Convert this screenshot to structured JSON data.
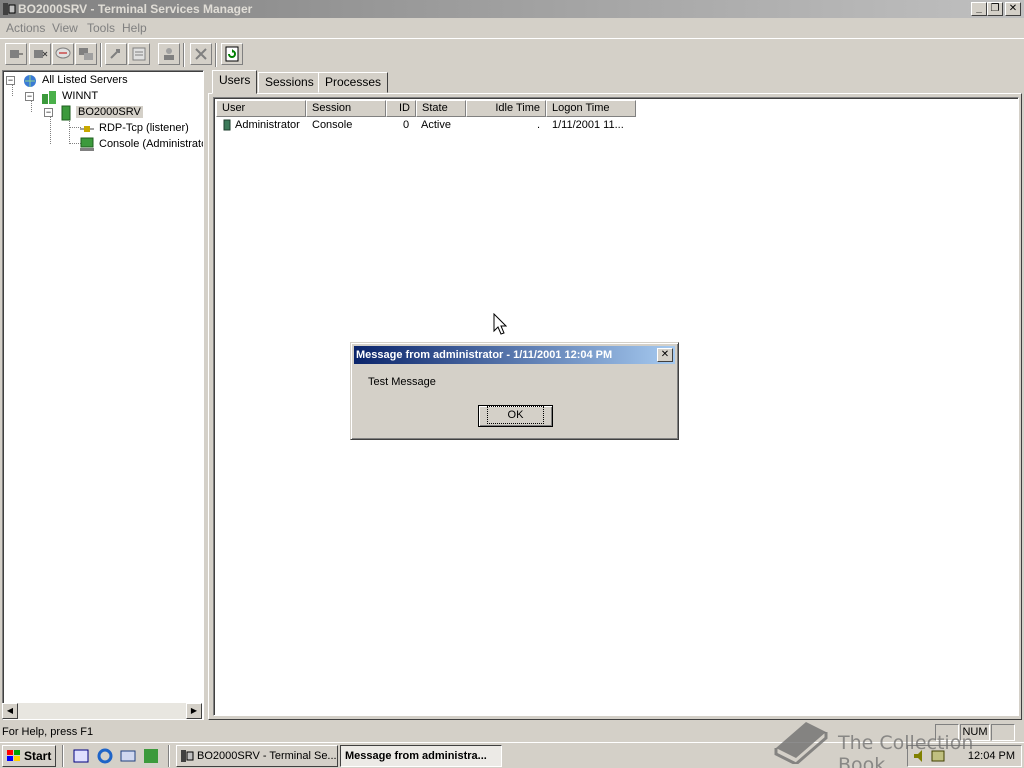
{
  "window": {
    "title": "BO2000SRV - Terminal Services Manager",
    "caption_buttons": {
      "minimize": "_",
      "restore": "❐",
      "close": "✕"
    }
  },
  "menu": [
    "Actions",
    "View",
    "Tools",
    "Help"
  ],
  "toolbar": {
    "buttons": [
      "connect-icon",
      "disconnect-icon",
      "send-message-icon",
      "remote-control-icon",
      "reset-icon",
      "status-icon",
      "logoff-icon",
      "end-process-icon",
      "refresh-icon"
    ]
  },
  "tree": {
    "root": "All Listed Servers",
    "domain": "WINNT",
    "server": "BO2000SRV",
    "sessions": [
      "RDP-Tcp (listener)",
      "Console (Administrato"
    ],
    "expander_minus": "−"
  },
  "tabs": [
    "Users",
    "Sessions",
    "Processes"
  ],
  "active_tab": "Users",
  "table": {
    "columns": [
      "User",
      "Session",
      "ID",
      "State",
      "Idle Time",
      "Logon Time"
    ],
    "rows": [
      {
        "user": "Administrator",
        "session": "Console",
        "id": "0",
        "state": "Active",
        "idle": ".",
        "logon": "1/11/2001 11..."
      }
    ]
  },
  "statusbar": {
    "text": "For Help, press F1",
    "num": "NUM"
  },
  "dialog": {
    "title": "Message from administrator - 1/11/2001 12:04 PM",
    "message": "Test Message",
    "ok": "OK",
    "close": "✕"
  },
  "taskbar": {
    "start": "Start",
    "tasks": [
      "BO2000SRV - Terminal Se...",
      "Message from administra..."
    ],
    "clock": "12:04 PM"
  },
  "watermark": "The Collection Book",
  "colors": {
    "active_title": "#0a246a",
    "inactive_title": "#808080",
    "face": "#d4d0c8"
  }
}
